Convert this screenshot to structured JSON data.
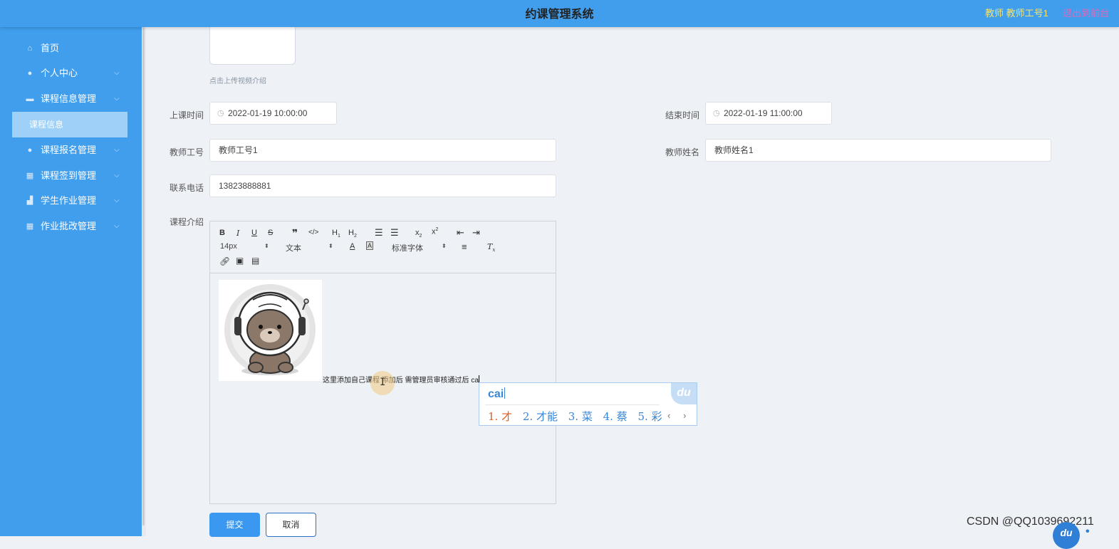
{
  "header": {
    "title": "约课管理系统",
    "user": "教师 教师工号1",
    "logout": "退出到前台"
  },
  "sidebar": {
    "items": [
      {
        "label": "首页",
        "icon": "home-icon"
      },
      {
        "label": "个人中心",
        "icon": "user-icon"
      },
      {
        "label": "课程信息管理",
        "icon": "chat-icon"
      },
      {
        "label": "课程报名管理",
        "icon": "location-icon"
      },
      {
        "label": "课程签到管理",
        "icon": "grid-icon"
      },
      {
        "label": "学生作业管理",
        "icon": "thumbs-up-icon"
      },
      {
        "label": "作业批改管理",
        "icon": "menu-icon"
      }
    ],
    "active_sub": "课程信息"
  },
  "form": {
    "upload_hint": "点击上传视频介绍",
    "start_time_label": "上课时间",
    "start_time": "2022-01-19 10:00:00",
    "end_time_label": "结束时间",
    "end_time": "2022-01-19 11:00:00",
    "teacher_id_label": "教师工号",
    "teacher_id": "教师工号1",
    "teacher_name_label": "教师姓名",
    "teacher_name": "教师姓名1",
    "phone_label": "联系电话",
    "phone": "13823888881",
    "intro_label": "课程介绍"
  },
  "editor": {
    "font_size": "14px",
    "paragraph": "文本",
    "font_family": "标准字体",
    "content_text": "这里添加自己课程 添加后 需管理员审核通过后 ca"
  },
  "ime": {
    "pinyin": "cai",
    "logo": "du",
    "candidates": [
      "1. 才",
      "2. 才能",
      "3. 菜",
      "4. 蔡",
      "5. 彩"
    ]
  },
  "buttons": {
    "submit": "提交",
    "cancel": "取消"
  },
  "watermark": "CSDN @QQ1039692211"
}
